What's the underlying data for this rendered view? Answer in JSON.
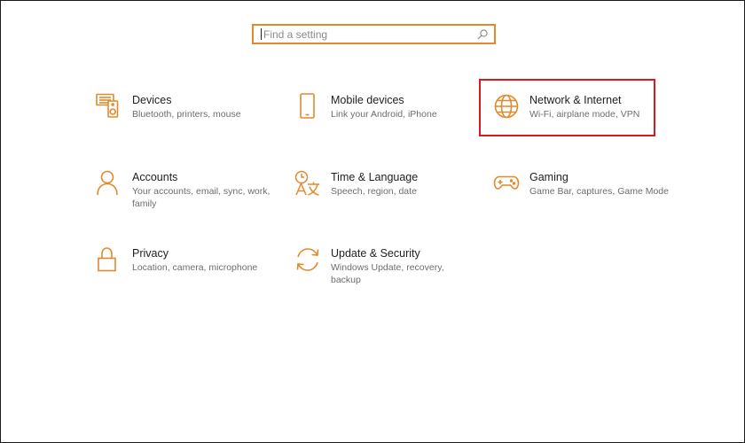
{
  "search": {
    "placeholder": "Find a setting"
  },
  "accent_color": "#e08a2c",
  "highlight_color": "#d71921",
  "tiles": [
    {
      "icon": "devices-icon",
      "title": "Devices",
      "subtitle": "Bluetooth, printers, mouse"
    },
    {
      "icon": "mobile-devices-icon",
      "title": "Mobile devices",
      "subtitle": "Link your Android, iPhone"
    },
    {
      "icon": "globe-icon",
      "title": "Network & Internet",
      "subtitle": "Wi-Fi, airplane mode, VPN"
    },
    {
      "icon": "person-icon",
      "title": "Accounts",
      "subtitle": "Your accounts, email, sync, work, family"
    },
    {
      "icon": "time-language-icon",
      "title": "Time & Language",
      "subtitle": "Speech, region, date"
    },
    {
      "icon": "gamepad-icon",
      "title": "Gaming",
      "subtitle": "Game Bar, captures, Game Mode"
    },
    {
      "icon": "lock-icon",
      "title": "Privacy",
      "subtitle": "Location, camera, microphone"
    },
    {
      "icon": "sync-icon",
      "title": "Update & Security",
      "subtitle": "Windows Update, recovery, backup"
    }
  ]
}
